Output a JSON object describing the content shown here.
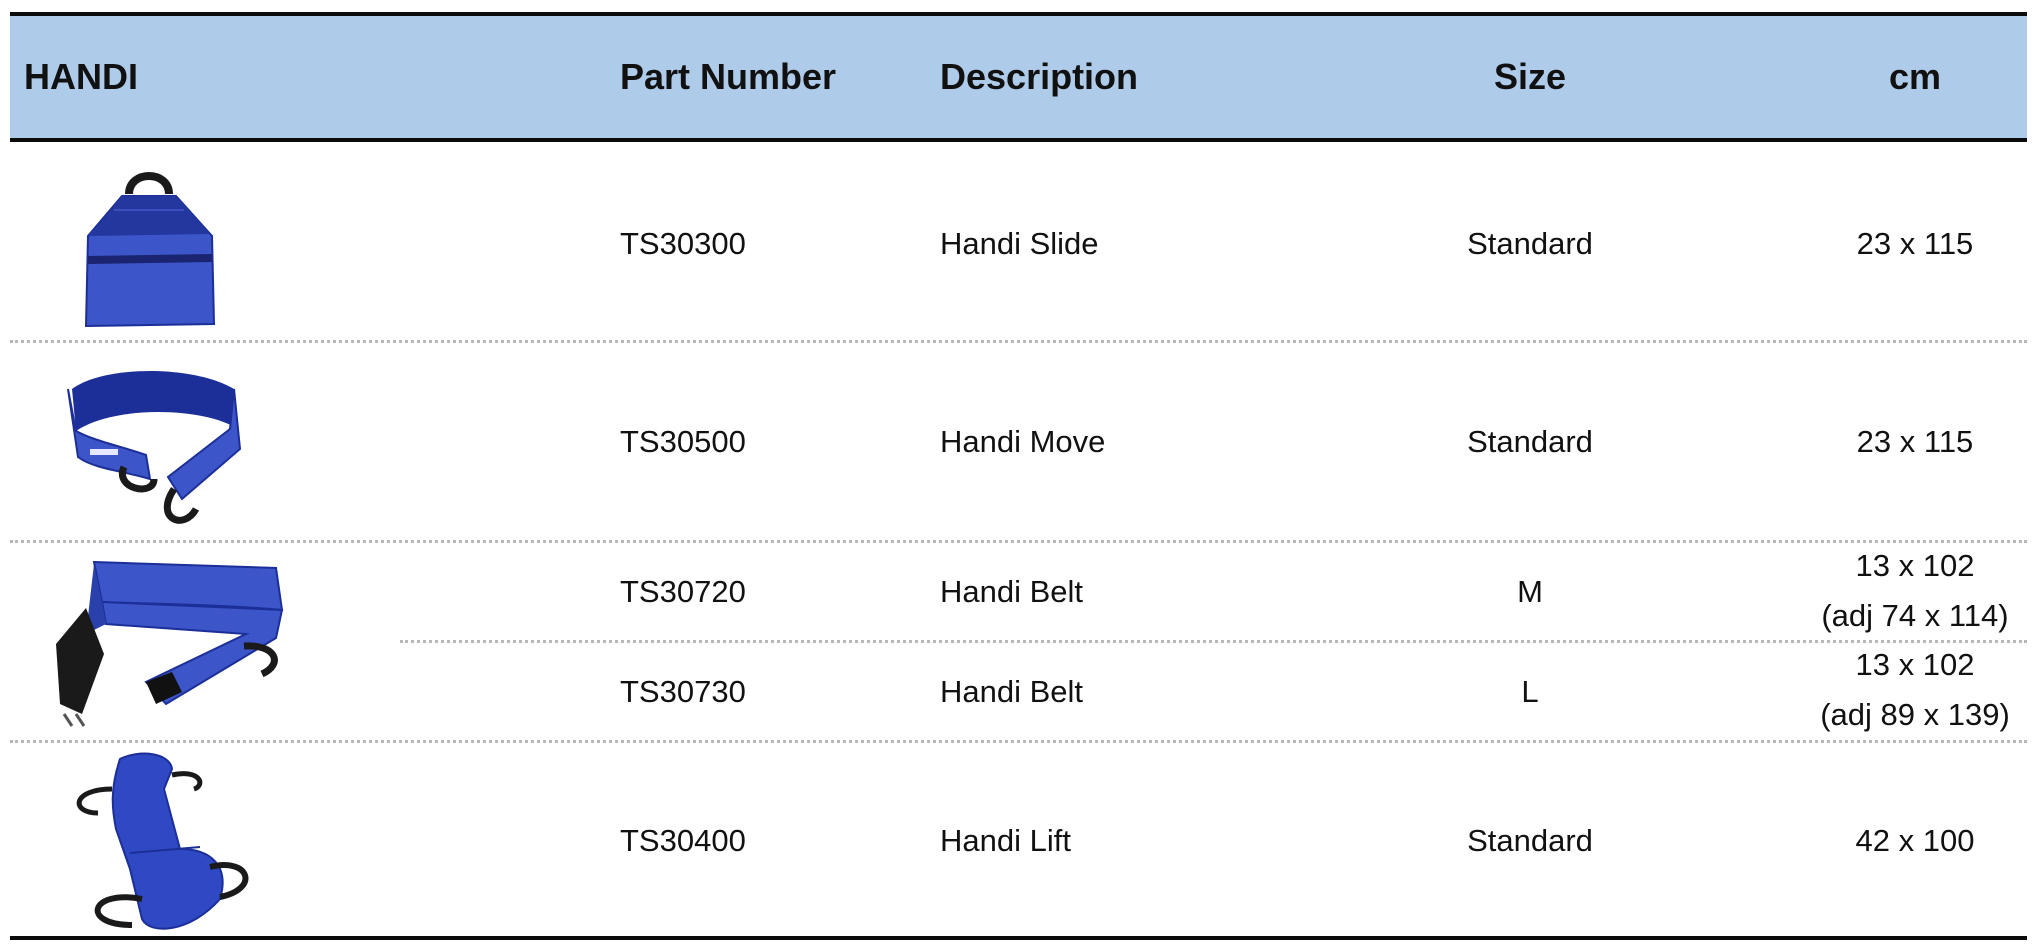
{
  "header": {
    "category": "HANDI",
    "part_number": "Part Number",
    "description": "Description",
    "size": "Size",
    "cm": "cm"
  },
  "rows": [
    {
      "part": "TS30300",
      "description": "Handi Slide",
      "size": "Standard",
      "cm": "23 x 115",
      "image_icon": "handi-slide-image"
    },
    {
      "part": "TS30500",
      "description": "Handi Move",
      "size": "Standard",
      "cm": "23 x 115",
      "image_icon": "handi-move-image"
    },
    {
      "part": "TS30720",
      "description": "Handi Belt",
      "size": "M",
      "cm_line1": "13 x 102",
      "cm_line2": "(adj 74 x 114)",
      "image_icon": "handi-belt-image"
    },
    {
      "part": "TS30730",
      "description": "Handi Belt",
      "size": "L",
      "cm_line1": "13 x 102",
      "cm_line2": "(adj 89 x 139)"
    },
    {
      "part": "TS30400",
      "description": "Handi Lift",
      "size": "Standard",
      "cm": "42 x 100",
      "image_icon": "handi-lift-image"
    }
  ],
  "colors": {
    "header_background": "#aecbea",
    "rule": "#0b0b0b",
    "product_blue": "#3c55c8",
    "product_dark_blue": "#1c2f98"
  }
}
